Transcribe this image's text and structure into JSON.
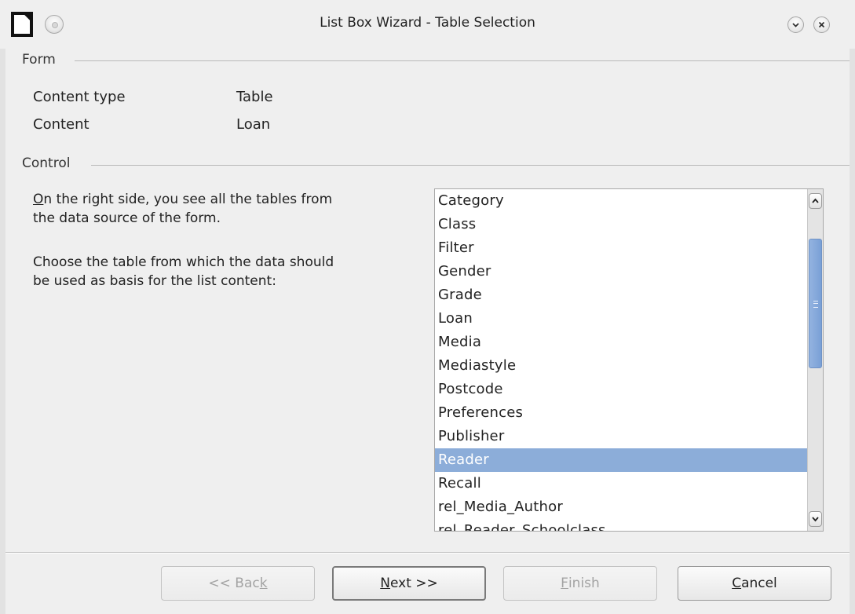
{
  "window": {
    "title": "List Box Wizard - Table Selection"
  },
  "form_group": {
    "header": "Form",
    "content_type_label": "Content type",
    "content_type_value": "Table",
    "content_label": "Content",
    "content_value": "Loan"
  },
  "control_group": {
    "header": "Control",
    "desc1_mnemonic": "O",
    "desc1_rest": "n the right side, you see all the tables from",
    "desc1_line2": "the data source of the form.",
    "desc2_line1": "Choose the table from which the data should",
    "desc2_line2": "be used as basis for the list content:"
  },
  "table_list": {
    "items": [
      "Category",
      "Class",
      "Filter",
      "Gender",
      "Grade",
      "Loan",
      "Media",
      "Mediastyle",
      "Postcode",
      "Preferences",
      "Publisher",
      "Reader",
      "Recall",
      "rel_Media_Author",
      "rel_Reader_Schoolclass"
    ],
    "selected": "Reader"
  },
  "buttons": {
    "back_pre": "<< Bac",
    "back_mnemonic": "k",
    "next_mnemonic": "N",
    "next_rest": "ext >>",
    "finish_mnemonic": "F",
    "finish_rest": "inish",
    "cancel_mnemonic": "C",
    "cancel_rest": "ancel"
  },
  "icons": {
    "app": "libreoffice-document-icon",
    "pin": "pin-icon",
    "minimize": "chevron-down-icon",
    "close": "close-icon",
    "scroll_up": "chevron-up-icon",
    "scroll_down": "chevron-down-icon"
  },
  "colors": {
    "selection": "#8cadd9",
    "scroll_thumb": "#7aa0d6"
  }
}
